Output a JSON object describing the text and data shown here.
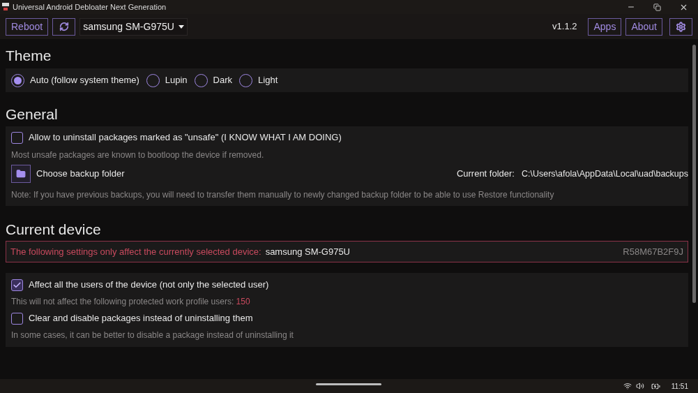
{
  "window": {
    "title": "Universal Android Debloater Next Generation"
  },
  "toolbar": {
    "reboot": "Reboot",
    "device": "samsung SM-G975U",
    "version": "v1.1.2",
    "apps": "Apps",
    "about": "About"
  },
  "theme": {
    "heading": "Theme",
    "options": [
      {
        "label": "Auto (follow system theme)",
        "selected": true
      },
      {
        "label": "Lupin",
        "selected": false
      },
      {
        "label": "Dark",
        "selected": false
      },
      {
        "label": "Light",
        "selected": false
      }
    ]
  },
  "general": {
    "heading": "General",
    "unsafe": {
      "label": "Allow to uninstall packages marked as \"unsafe\" (I KNOW WHAT I AM DOING)",
      "checked": false,
      "hint": "Most unsafe packages are known to bootloop the device if removed."
    },
    "backup_button": "Choose backup folder",
    "current_folder_label": "Current folder:",
    "current_folder": "C:\\Users\\afola\\AppData\\Local\\uad\\backups",
    "note": "Note: If you have previous backups, you will need to transfer them manually to newly changed backup folder to be able to use Restore functionality"
  },
  "current_device": {
    "heading": "Current device",
    "warning": "The following settings only affect the currently selected device:",
    "device": "samsung SM-G975U",
    "serial": "R58M67B2F9J",
    "options": [
      {
        "label": "Affect all the users of the device (not only the selected user)",
        "checked": true,
        "hint": "This will not affect the following protected work profile users:",
        "hint_value": "150"
      },
      {
        "label": "Clear and disable packages instead of uninstalling them",
        "checked": false,
        "hint": "In some cases, it can be better to disable a package instead of uninstalling it"
      }
    ]
  },
  "taskbar": {
    "time": "11:51"
  }
}
